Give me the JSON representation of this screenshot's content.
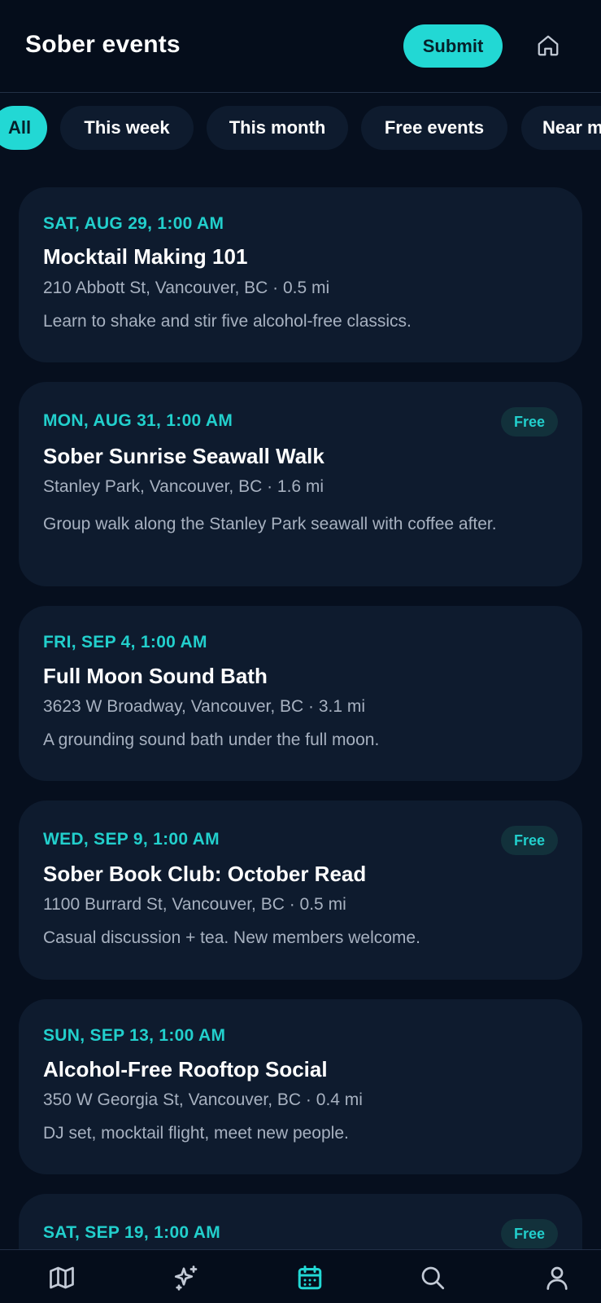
{
  "header": {
    "title": "Sober events",
    "submit_label": "Submit",
    "home_icon": "home-icon"
  },
  "filters": [
    {
      "label": "All",
      "active": true
    },
    {
      "label": "This week",
      "active": false
    },
    {
      "label": "This month",
      "active": false
    },
    {
      "label": "Free events",
      "active": false
    },
    {
      "label": "Near m",
      "active": false
    }
  ],
  "events": [
    {
      "date": "SAT, AUG 29, 1:00 AM",
      "title": "Mocktail Making 101",
      "location": "210 Abbott St, Vancouver, BC · 0.5 mi",
      "description": "Learn to shake and stir five alcohol-free classics.",
      "badge": ""
    },
    {
      "date": "MON, AUG 31, 1:00 AM",
      "title": "Sober Sunrise Seawall Walk",
      "location": "Stanley Park, Vancouver, BC · 1.6 mi",
      "description": "Group walk along the Stanley Park seawall with coffee after.",
      "badge": "Free"
    },
    {
      "date": "FRI, SEP 4, 1:00 AM",
      "title": "Full Moon Sound Bath",
      "location": "3623 W Broadway, Vancouver, BC · 3.1 mi",
      "description": "A grounding sound bath under the full moon.",
      "badge": ""
    },
    {
      "date": "WED, SEP 9, 1:00 AM",
      "title": "Sober Book Club: October Read",
      "location": "1100 Burrard St, Vancouver, BC · 0.5 mi",
      "description": "Casual discussion + tea. New members welcome.",
      "badge": "Free"
    },
    {
      "date": "SUN, SEP 13, 1:00 AM",
      "title": "Alcohol-Free Rooftop Social",
      "location": "350 W Georgia St, Vancouver, BC · 0.4 mi",
      "description": "DJ set, mocktail flight, meet new people.",
      "badge": ""
    },
    {
      "date": "SAT, SEP 19, 1:00 AM",
      "badge": "Free"
    }
  ],
  "bottom_nav": [
    {
      "icon": "map-icon",
      "active": false
    },
    {
      "icon": "sparkles-icon",
      "active": false
    },
    {
      "icon": "calendar-icon",
      "active": true
    },
    {
      "icon": "search-icon",
      "active": false
    },
    {
      "icon": "profile-icon",
      "active": false
    }
  ],
  "colors": {
    "accent": "#22d8d4",
    "background": "#060f1e",
    "card": "#0e1b2e",
    "muted_text": "#a7b1c0",
    "nav_inactive": "#c3cad6"
  }
}
